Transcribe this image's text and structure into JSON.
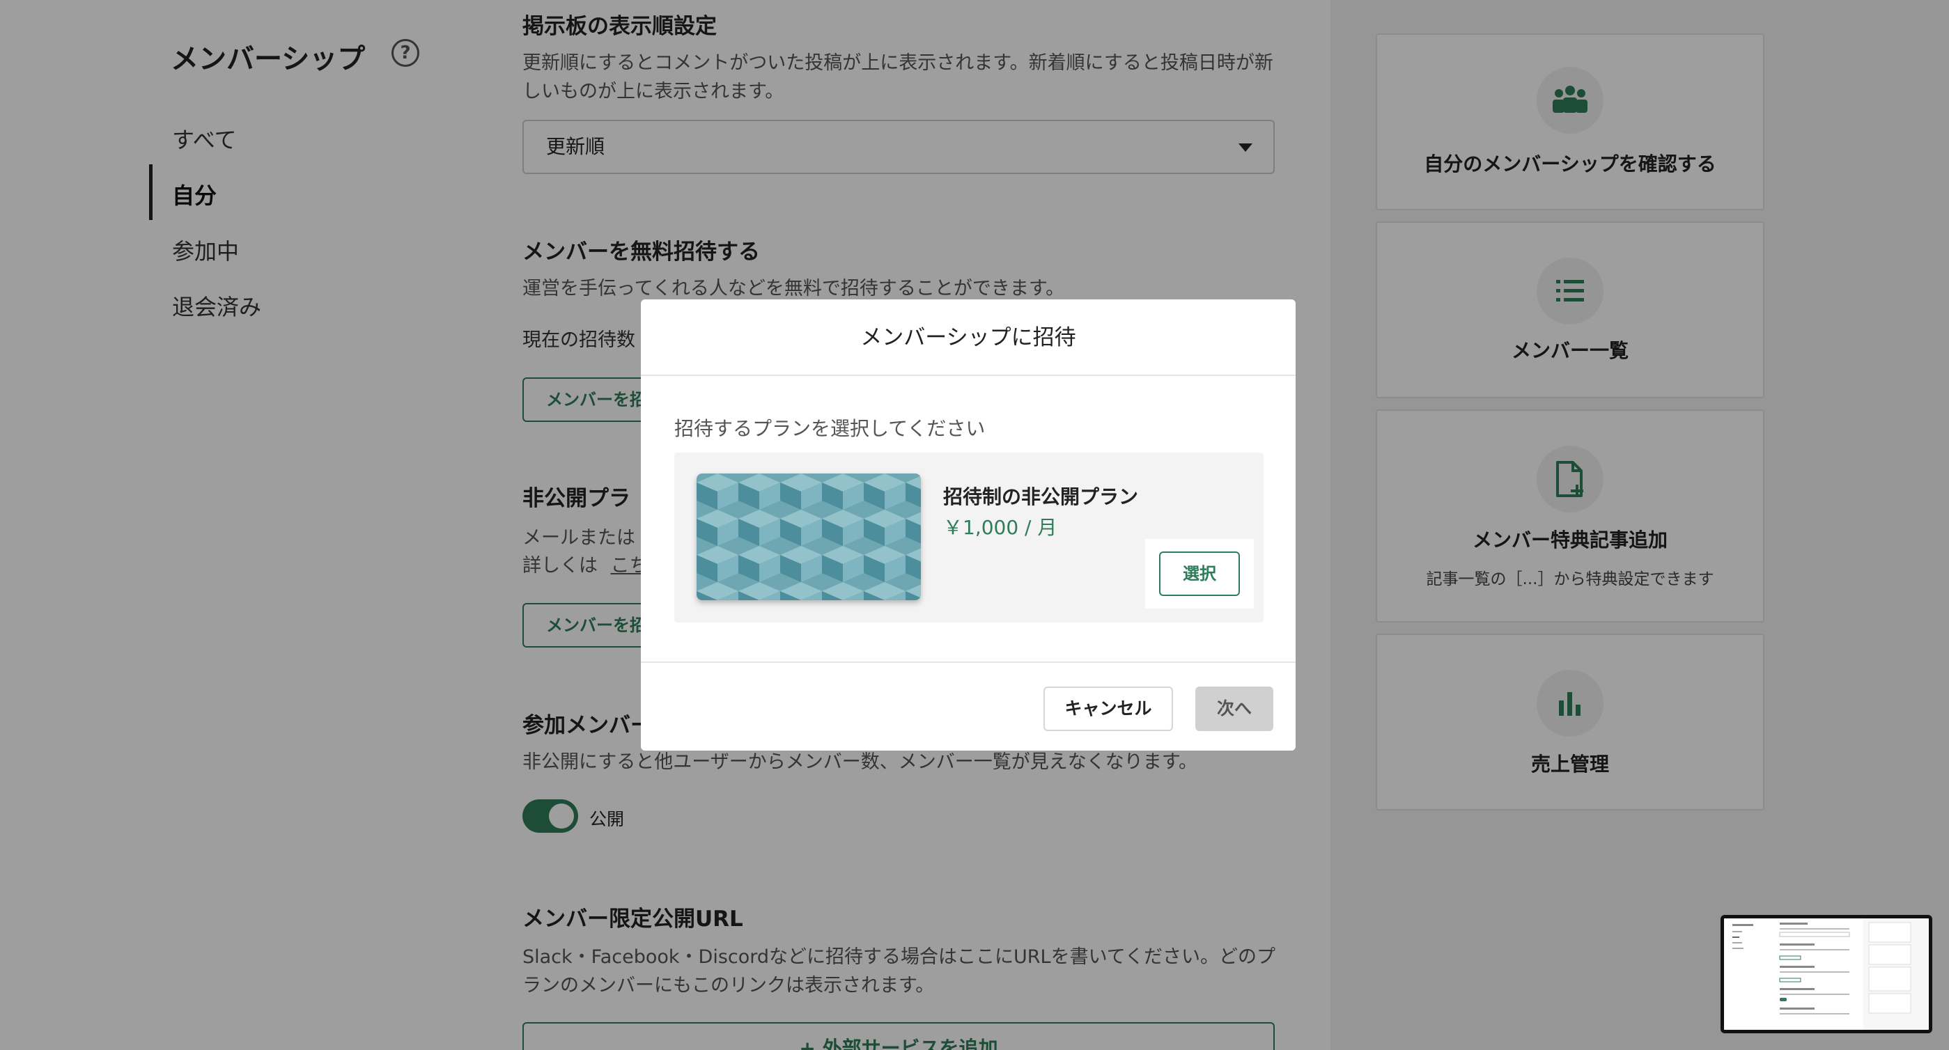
{
  "sidebar": {
    "title": "メンバーシップ",
    "help": "?",
    "items": [
      {
        "label": "すべて"
      },
      {
        "label": "自分",
        "active": true
      },
      {
        "label": "参加中"
      },
      {
        "label": "退会済み"
      }
    ]
  },
  "main": {
    "board_order": {
      "title": "掲示板の表示順設定",
      "desc": "更新順にするとコメントがついた投稿が上に表示されます。新着順にすると投稿日時が新しいものが上に表示されます。",
      "select_value": "更新順"
    },
    "invite_free": {
      "title": "メンバーを無料招待する",
      "desc": "運営を手伝ってくれる人などを無料で招待することができます。",
      "current": "現在の招待数",
      "button": "メンバーを招"
    },
    "private_plan": {
      "title": "非公開プラ",
      "desc_line1": "メールまたは",
      "desc_line2_prefix": "詳しくは",
      "desc_link": "こち",
      "button": "メンバーを招"
    },
    "member_count": {
      "title": "参加メンバー",
      "desc": "非公開にすると他ユーザーからメンバー数、メンバー一覧が見えなくなります。",
      "toggle_label": "公開",
      "toggle_on": true
    },
    "limited_url": {
      "title": "メンバー限定公開URL",
      "desc": "Slack・Facebook・Discordなどに招待する場合はここにURLを書いてください。どのプランのメンバーにもこのリンクは表示されます。",
      "add_button": "+ 外部サービスを追加"
    }
  },
  "right_cards": [
    {
      "icon": "people-group-icon",
      "title": "自分のメンバーシップを確認する"
    },
    {
      "icon": "list-icon",
      "title": "メンバー一覧"
    },
    {
      "icon": "file-add-icon",
      "title": "メンバー特典記事追加",
      "sub": "記事一覧の［...］から特典設定できます"
    },
    {
      "icon": "bar-chart-icon",
      "title": "売上管理"
    }
  ],
  "modal": {
    "title": "メンバーシップに招待",
    "prompt": "招待するプランを選択してください",
    "plan": {
      "name": "招待制の非公開プラン",
      "price": "￥1,000 / 月",
      "select_label": "選択"
    },
    "cancel_label": "キャンセル",
    "next_label": "次へ"
  },
  "colors": {
    "accent": "#2f7c5a",
    "overlay": "rgba(0,0,0,0.38)",
    "plan_pattern_light": "#7fb5c0",
    "plan_pattern_dark": "#4d8e9c"
  }
}
